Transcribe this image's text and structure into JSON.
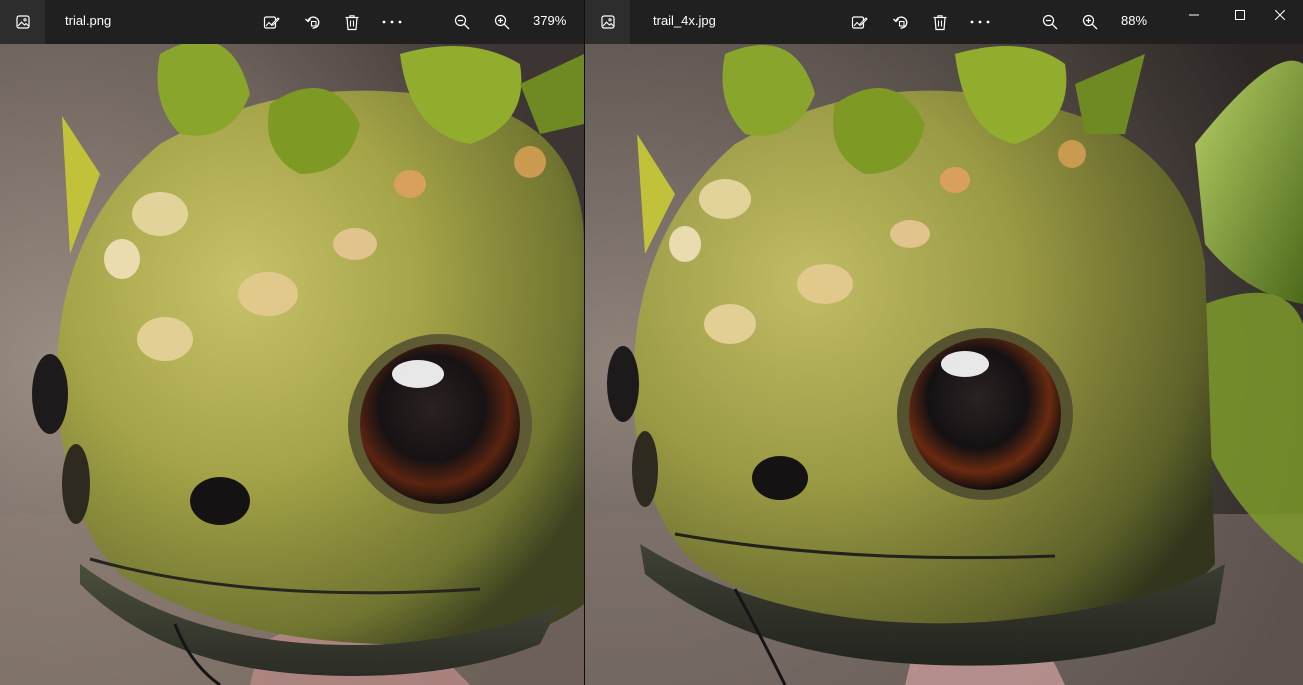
{
  "left_viewer": {
    "title": "trial.png",
    "zoom_level": "379%",
    "toolbar": {
      "app_icon": "photo-icon",
      "edit_icon": "edit-image-icon",
      "rotate_icon": "rotate-icon",
      "delete_icon": "delete-icon",
      "more_icon": "more-options-icon",
      "zoom_out_icon": "zoom-out-icon",
      "zoom_in_icon": "zoom-in-icon"
    }
  },
  "right_viewer": {
    "title": "trail_4x.jpg",
    "zoom_level": "88%",
    "toolbar": {
      "app_icon": "photo-icon",
      "edit_icon": "edit-image-icon",
      "rotate_icon": "rotate-icon",
      "delete_icon": "delete-icon",
      "more_icon": "more-options-icon",
      "zoom_out_icon": "zoom-out-icon",
      "zoom_in_icon": "zoom-in-icon"
    },
    "window_controls": [
      "minimize-icon",
      "maximize-icon",
      "close-icon"
    ]
  },
  "colors": {
    "titlebar_bg": "#202020",
    "titlebar_text": "#ffffff",
    "creature_skin": "#8f9a3e",
    "creature_skin_light": "#c9c267",
    "spike_green": "#8aa52b",
    "eye_dark": "#161314",
    "eye_iris": "#6b2a12",
    "background_blur": "#7a6f66",
    "leaf_green": "#9dbb3c"
  }
}
